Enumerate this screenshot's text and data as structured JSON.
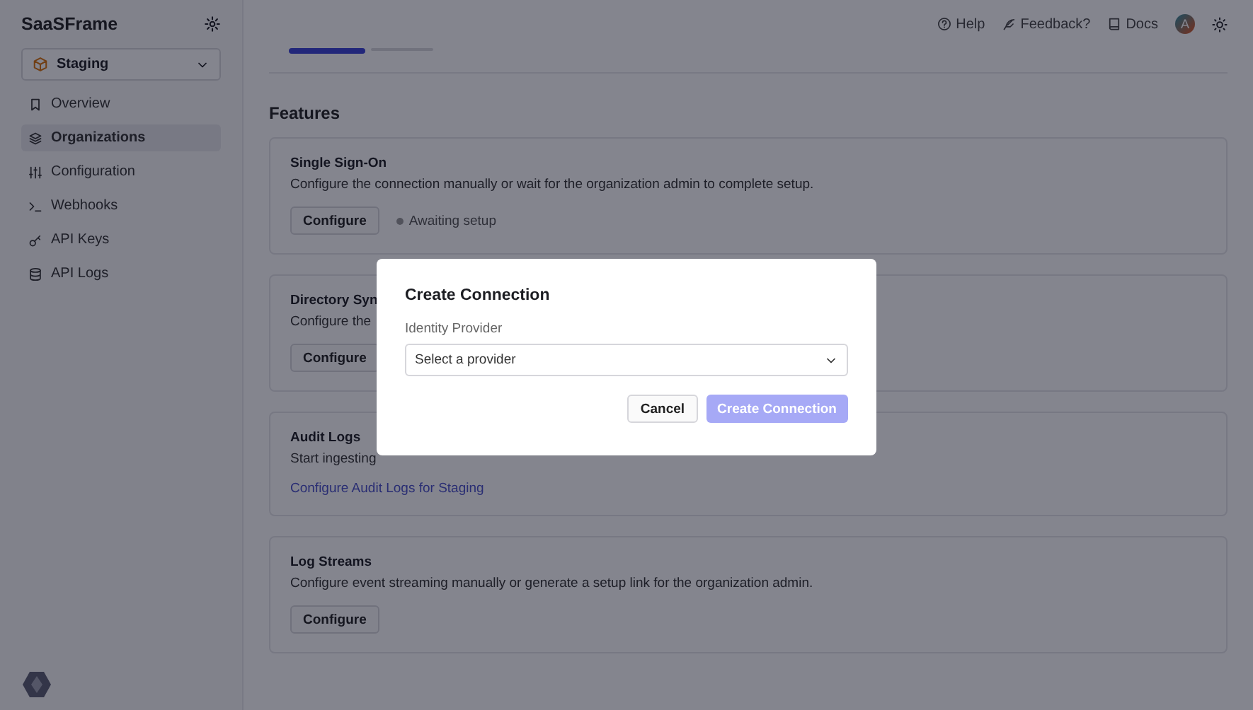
{
  "app": {
    "name": "SaaSFrame"
  },
  "environment": {
    "label": "Staging"
  },
  "sidebar": {
    "items": [
      {
        "label": "Overview",
        "selected": false
      },
      {
        "label": "Organizations",
        "selected": true
      },
      {
        "label": "Configuration",
        "selected": false
      },
      {
        "label": "Webhooks",
        "selected": false
      },
      {
        "label": "API Keys",
        "selected": false
      },
      {
        "label": "API Logs",
        "selected": false
      }
    ]
  },
  "topbar": {
    "links": [
      {
        "label": "Help"
      },
      {
        "label": "Feedback?"
      },
      {
        "label": "Docs"
      }
    ],
    "avatar": "A"
  },
  "tabs": [
    {
      "selected": true
    },
    {
      "selected": false
    }
  ],
  "features": {
    "title": "Features",
    "cards": [
      {
        "title": "Single Sign-On",
        "description": "Configure the connection manually or wait for the organization admin to complete setup.",
        "action": {
          "kind": "button",
          "label": "Configure"
        },
        "status": "Awaiting setup"
      },
      {
        "title": "Directory Syn",
        "description": "Configure the",
        "action": {
          "kind": "button",
          "label": "Configure"
        }
      },
      {
        "title": "Audit Logs",
        "description": "Start ingesting",
        "action": {
          "kind": "link",
          "label": "Configure Audit Logs for Staging"
        }
      },
      {
        "title": "Log Streams",
        "description": "Configure event streaming manually or generate a setup link for the organization admin.",
        "action": {
          "kind": "button",
          "label": "Configure"
        }
      }
    ]
  },
  "dialog": {
    "title": "Create Connection",
    "field": {
      "label": "Identity Provider",
      "placeholder": "Select a provider"
    },
    "buttons": [
      {
        "label": "Cancel",
        "kind": "secondary",
        "disabled": false
      },
      {
        "label": "Create Connection",
        "kind": "primary",
        "disabled": true
      }
    ]
  }
}
